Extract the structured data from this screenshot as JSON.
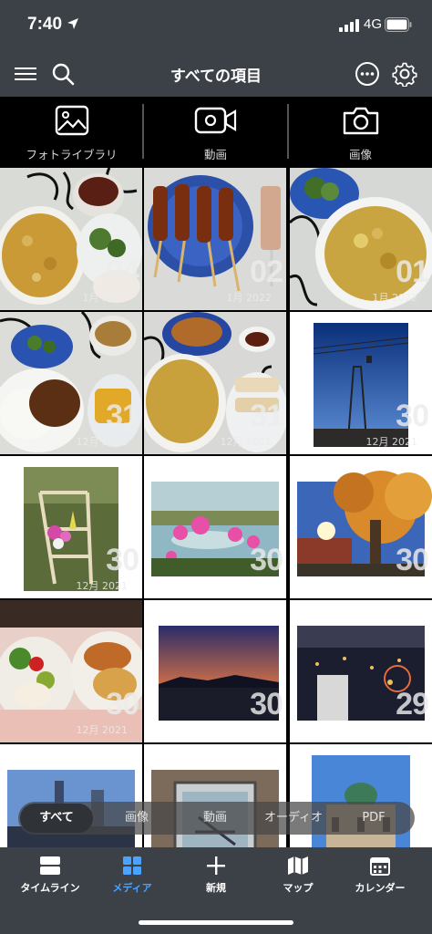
{
  "status": {
    "time": "7:40",
    "network": "4G"
  },
  "header": {
    "title": "すべての項目",
    "icons": [
      "menu-icon",
      "search-icon",
      "more-icon",
      "gear-icon"
    ]
  },
  "sources": [
    {
      "label": "フォトライブラリ",
      "icon": "photo-library-icon"
    },
    {
      "label": "動画",
      "icon": "video-camera-icon"
    },
    {
      "label": "画像",
      "icon": "camera-icon"
    }
  ],
  "grid": [
    {
      "day": "04",
      "month": "1月 2022"
    },
    {
      "day": "02",
      "month": "1月 2022"
    },
    {
      "day": "01",
      "month": "1月 2022"
    },
    {
      "day": "31",
      "month": "12月 2021"
    },
    {
      "day": "31",
      "month": "12月 2021"
    },
    {
      "day": "30",
      "month": "12月 2021"
    },
    {
      "day": "30",
      "month": "12月 2021"
    },
    {
      "day": "30",
      "month": ""
    },
    {
      "day": "30",
      "month": ""
    },
    {
      "day": "30",
      "month": "12月 2021"
    },
    {
      "day": "30",
      "month": ""
    },
    {
      "day": "29",
      "month": ""
    }
  ],
  "filters": [
    "すべて",
    "画像",
    "動画",
    "オーディオ",
    "PDF"
  ],
  "tabs": [
    {
      "label": "タイムライン",
      "icon": "timeline-icon"
    },
    {
      "label": "メディア",
      "icon": "media-grid-icon"
    },
    {
      "label": "新規",
      "icon": "plus-icon"
    },
    {
      "label": "マップ",
      "icon": "map-icon"
    },
    {
      "label": "カレンダー",
      "icon": "calendar-icon"
    }
  ],
  "colors": {
    "bar": "#3b4147",
    "accent": "#4aa3ff"
  }
}
